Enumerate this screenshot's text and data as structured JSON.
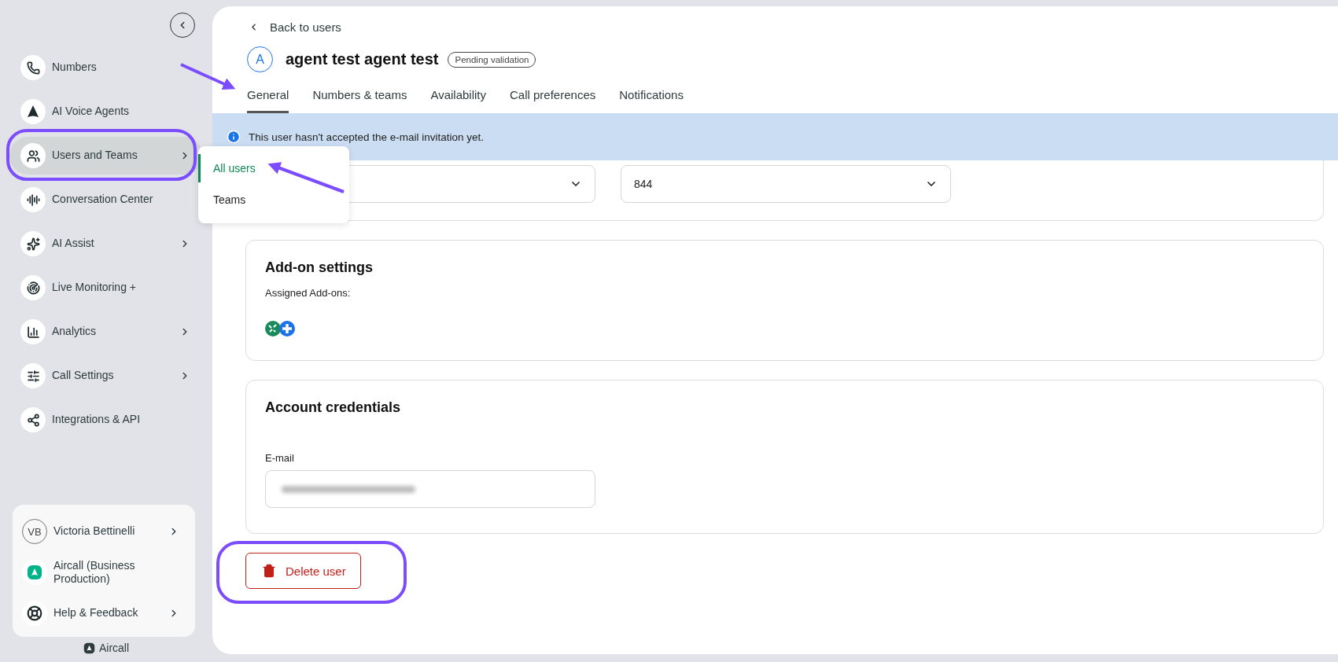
{
  "sidebar": {
    "nav_items": [
      {
        "label": "Numbers",
        "has_submenu": false,
        "selected": false
      },
      {
        "label": "AI Voice Agents",
        "has_submenu": false,
        "selected": false
      },
      {
        "label": "Users and Teams",
        "has_submenu": true,
        "selected": true
      },
      {
        "label": "Conversation Center",
        "has_submenu": false,
        "selected": false
      },
      {
        "label": "AI Assist",
        "has_submenu": true,
        "selected": false
      },
      {
        "label": "Live Monitoring +",
        "has_submenu": false,
        "selected": false
      },
      {
        "label": "Analytics",
        "has_submenu": true,
        "selected": false
      },
      {
        "label": "Call Settings",
        "has_submenu": true,
        "selected": false
      },
      {
        "label": "Integrations & API",
        "has_submenu": false,
        "selected": false
      }
    ],
    "account_items": [
      {
        "kind": "user",
        "initials": "VB",
        "label": "Victoria Bettinelli",
        "has_submenu": true
      },
      {
        "kind": "workspace",
        "label": "Aircall (Business Production)",
        "has_submenu": false
      },
      {
        "kind": "help",
        "label": "Help & Feedback",
        "has_submenu": true
      }
    ],
    "footer": "Aircall"
  },
  "submenu": {
    "items": [
      {
        "label": "All users",
        "selected": true
      },
      {
        "label": "Teams",
        "selected": false
      }
    ]
  },
  "main": {
    "back_link": "Back to users",
    "user": {
      "avatar_initial": "A",
      "name": "agent test agent test",
      "status_badge": "Pending validation"
    },
    "tabs": [
      {
        "label": "General",
        "selected": true
      },
      {
        "label": "Numbers & teams",
        "selected": false
      },
      {
        "label": "Availability",
        "selected": false
      },
      {
        "label": "Call preferences",
        "selected": false
      },
      {
        "label": "Notifications",
        "selected": false
      }
    ],
    "banner": "This user hasn't accepted the e-mail invitation yet.",
    "selects": [
      {
        "expanded": false
      },
      {
        "value": "844",
        "expanded": false
      }
    ],
    "addon_settings": {
      "title": "Add-on settings",
      "label": "Assigned Add-ons:",
      "addons": [
        {
          "color": "#1b8a5a"
        },
        {
          "color": "#1a73e8"
        }
      ]
    },
    "account_credentials": {
      "title": "Account credentials",
      "email_label": "E-mail",
      "email_redacted": true
    },
    "delete_button": "Delete user"
  }
}
